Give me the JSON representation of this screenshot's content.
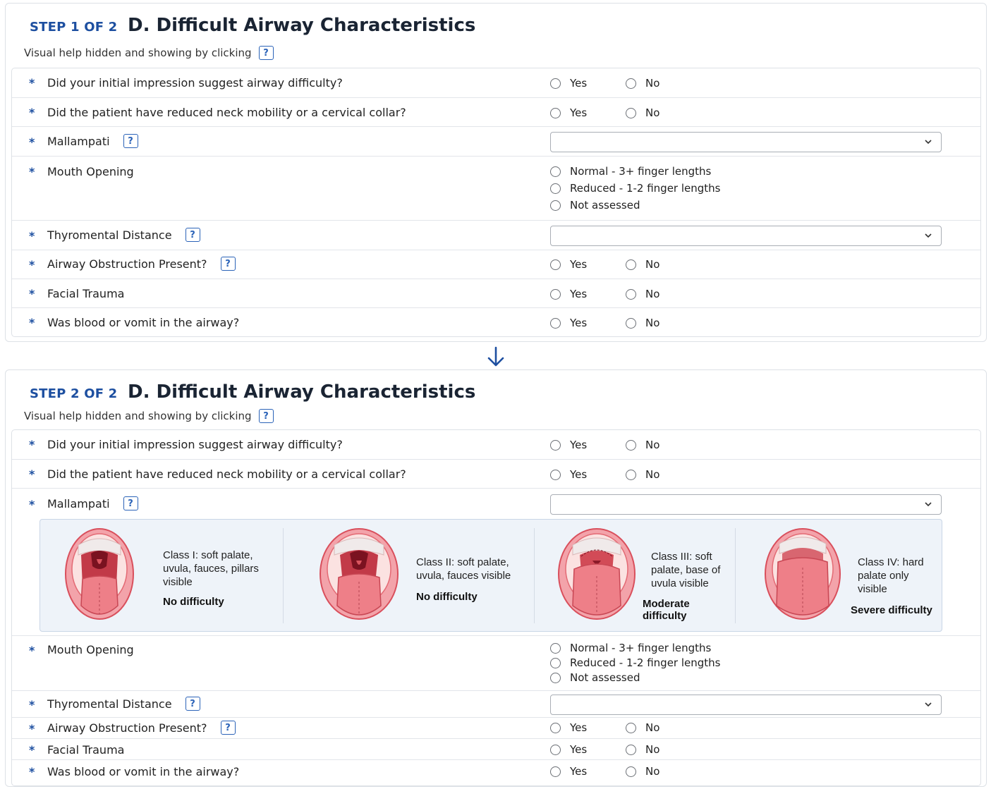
{
  "step1": {
    "step_label": "STEP 1 OF 2",
    "title": "D. Difficult Airway Characteristics",
    "help_text": "Visual help hidden and showing by clicking",
    "help_icon": "?",
    "required_mark": "*",
    "q1": {
      "label": "Did your initial impression suggest airway difficulty?",
      "yes": "Yes",
      "no": "No"
    },
    "q2": {
      "label": "Did the patient have reduced neck mobility or a cervical collar?",
      "yes": "Yes",
      "no": "No"
    },
    "q3": {
      "label": "Mallampati",
      "value": ""
    },
    "q4": {
      "label": "Mouth Opening",
      "opt1": "Normal - 3+ finger lengths",
      "opt2": "Reduced - 1-2 finger lengths",
      "opt3": "Not assessed"
    },
    "q5": {
      "label": "Thyromental Distance",
      "value": ""
    },
    "q6": {
      "label": "Airway Obstruction Present?",
      "yes": "Yes",
      "no": "No"
    },
    "q7": {
      "label": "Facial Trauma",
      "yes": "Yes",
      "no": "No"
    },
    "q8": {
      "label": "Was blood or vomit in the airway?",
      "yes": "Yes",
      "no": "No"
    }
  },
  "step2": {
    "step_label": "STEP 2 OF 2",
    "title": "D. Difficult Airway Characteristics",
    "help_text": "Visual help hidden and showing by clicking",
    "help_icon": "?",
    "required_mark": "*",
    "q1": {
      "label": "Did your initial impression suggest airway difficulty?",
      "yes": "Yes",
      "no": "No"
    },
    "q2": {
      "label": "Did the patient have reduced neck mobility or a cervical collar?",
      "yes": "Yes",
      "no": "No"
    },
    "q3": {
      "label": "Mallampati",
      "value": ""
    },
    "mallampati_help": [
      {
        "desc_lines": [
          "Class I: soft palate,",
          "uvula, fauces, pillars",
          "visible"
        ],
        "difficulty": "No difficulty"
      },
      {
        "desc_lines": [
          "Class II: soft palate,",
          "uvula, fauces visible"
        ],
        "difficulty": "No difficulty"
      },
      {
        "desc_lines": [
          "Class III: soft",
          "palate, base of",
          "uvula visible"
        ],
        "difficulty": "Moderate difficulty"
      },
      {
        "desc_lines": [
          "Class IV: hard",
          "palate only",
          "visible"
        ],
        "difficulty": "Severe difficulty"
      }
    ],
    "q4": {
      "label": "Mouth Opening",
      "opt1": "Normal - 3+ finger lengths",
      "opt2": "Reduced - 1-2 finger lengths",
      "opt3": "Not assessed"
    },
    "q5": {
      "label": "Thyromental Distance",
      "value": ""
    },
    "q6": {
      "label": "Airway Obstruction Present?",
      "yes": "Yes",
      "no": "No"
    },
    "q7": {
      "label": "Facial Trauma",
      "yes": "Yes",
      "no": "No"
    },
    "q8": {
      "label": "Was blood or vomit in the airway?",
      "yes": "Yes",
      "no": "No"
    }
  },
  "colors": {
    "accent": "#1d4fa0",
    "help_border": "#2b63b8",
    "panel_bg": "#eef3f9",
    "mouth_red": "#e05a66"
  },
  "icons": {
    "help": "question-mark-icon",
    "dropdown": "chevron-down-icon",
    "step_arrow": "arrow-down-icon"
  }
}
